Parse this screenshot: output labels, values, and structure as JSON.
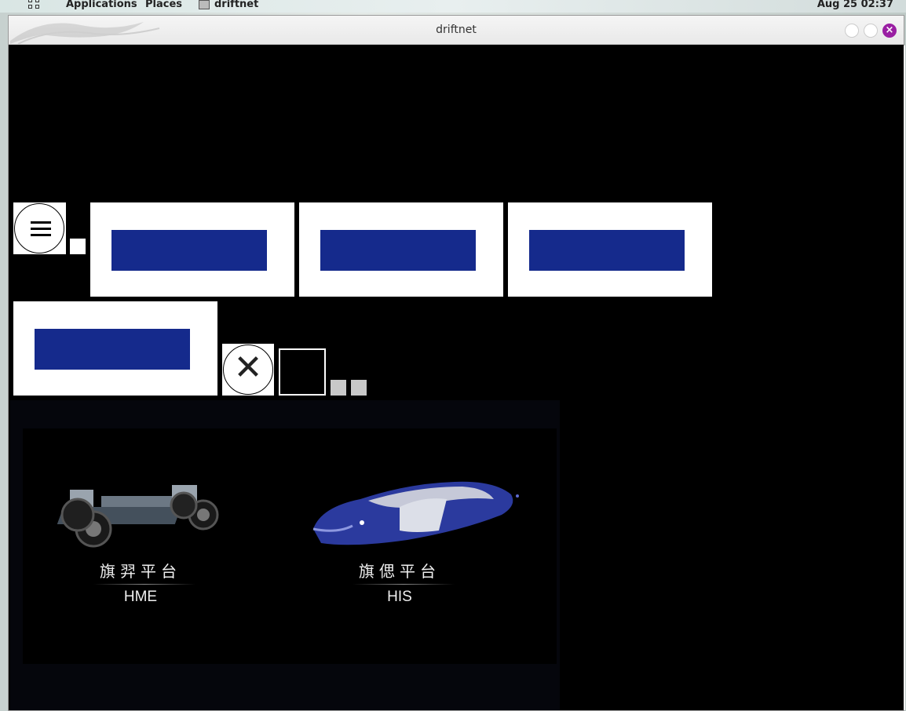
{
  "top_panel": {
    "applications_label": "Applications",
    "places_label": "Places",
    "active_window_label": "driftnet",
    "clock": "Aug 25  02:37"
  },
  "window": {
    "title": "driftnet",
    "close_glyph": "×"
  },
  "content": {
    "menu_icon": "hamburger-icon",
    "close_icon": "close-x-icon",
    "close_glyph": "✕",
    "nav_bar_color": "#152a8c"
  },
  "platforms": [
    {
      "name": "旗羿平台",
      "code": "HME",
      "image": "car-chassis-image"
    },
    {
      "name": "旗偲平台",
      "code": "HIS",
      "image": "concept-car-image"
    }
  ],
  "colors": {
    "close_button": "#9a1fa3",
    "nav_blue": "#152a8c"
  }
}
